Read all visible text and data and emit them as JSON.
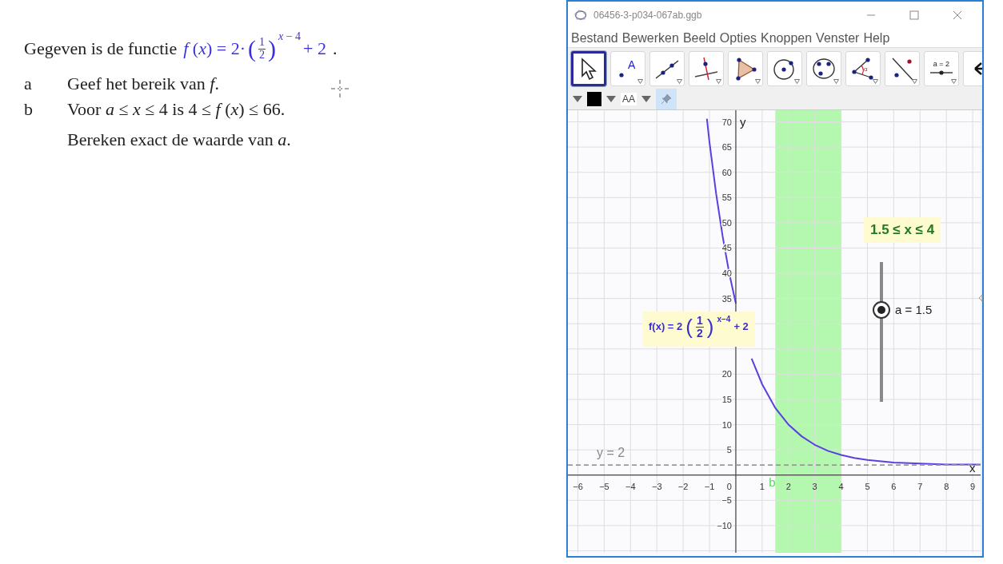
{
  "document": {
    "intro": {
      "text": "Gegeven is de functie",
      "formula": {
        "lhs": "*f* (*x*) = 2·",
        "open": "(",
        "close": ")",
        "numerator": "1",
        "denominator": "2",
        "exponent": "*x* − 4",
        "tail": "+ 2"
      },
      "end": "."
    },
    "questions": [
      {
        "label": "a",
        "lines": [
          "Geef het bereik van *f*."
        ]
      },
      {
        "label": "b",
        "lines": [
          "Voor *a* ≤ *x* ≤ 4 is 4 ≤ *f* (*x*) ≤ 66.",
          "Bereken exact de waarde van *a*."
        ]
      }
    ]
  },
  "window": {
    "title": "06456-3-p034-067ab.ggb",
    "menu": [
      "Bestand",
      "Bewerken",
      "Beeld",
      "Opties",
      "Knoppen",
      "Venster",
      "Help"
    ],
    "tools": [
      {
        "kind": "move",
        "selected": true
      },
      {
        "kind": "point",
        "label": "A",
        "selected": false
      },
      {
        "kind": "line",
        "selected": false
      },
      {
        "kind": "perpendicular",
        "selected": false
      },
      {
        "kind": "polygon",
        "selected": false
      },
      {
        "kind": "circle",
        "selected": false
      },
      {
        "kind": "conic",
        "selected": false
      },
      {
        "kind": "angle",
        "label": "α",
        "selected": false
      },
      {
        "kind": "reflect",
        "selected": false
      },
      {
        "kind": "slider",
        "label": "a = 2",
        "selected": false
      },
      {
        "kind": "more",
        "selected": false
      }
    ],
    "style_bar": {
      "color": "#000000",
      "font_button": "AA",
      "pin": {
        "selected": true
      }
    },
    "graphics": {
      "chart_data": {
        "type": "line",
        "xlabel": "x",
        "ylabel": "y",
        "x": [
          -1.1,
          -1,
          -0.75,
          -0.5,
          -0.25,
          0,
          0.25,
          0.5,
          0.6,
          1,
          1.5,
          2,
          2.5,
          3,
          3.5,
          4,
          4.5,
          5,
          6,
          7,
          8,
          9,
          9.3
        ],
        "series": [
          {
            "color": "#5b3fe0",
            "values": [
              70.6,
              66,
              55.8,
              47.3,
              40,
              34,
              null,
              null,
              23.1,
              18,
              13.3,
              10,
              7.7,
              6,
              4.8,
              4,
              3.4,
              3,
              2.5,
              2.3,
              2.1,
              2.1,
              2.1
            ]
          }
        ],
        "grid": true,
        "xlim": [
          -6.38,
          9.3
        ],
        "ylim": [
          -15.4,
          72.3
        ],
        "xticks": [
          -6,
          -5,
          -4,
          -3,
          -2,
          -1,
          0,
          1,
          2,
          3,
          4,
          5,
          6,
          7,
          8,
          9
        ],
        "yticks": [
          -10,
          -5,
          5,
          10,
          15,
          20,
          35,
          40,
          45,
          50,
          55,
          60,
          65,
          70
        ],
        "bands": [
          {
            "axis": "x",
            "from": 1.5,
            "to": 4,
            "color": "#b4f8b0"
          }
        ],
        "ref_lines": [
          {
            "axis": "y",
            "value": 2,
            "label": "y = 2",
            "color": "#999999"
          }
        ]
      },
      "point_label": "b",
      "function_label": {
        "lhs": "f(x) = 2",
        "open": "(",
        "close": ")",
        "numerator": "1",
        "denominator": "2",
        "exponent": "x−4",
        "tail": "+ 2"
      },
      "interval_label": "1.5 ≤ x ≤ 4",
      "slider": {
        "label": "a = 1.5",
        "level": 0.66
      }
    }
  }
}
